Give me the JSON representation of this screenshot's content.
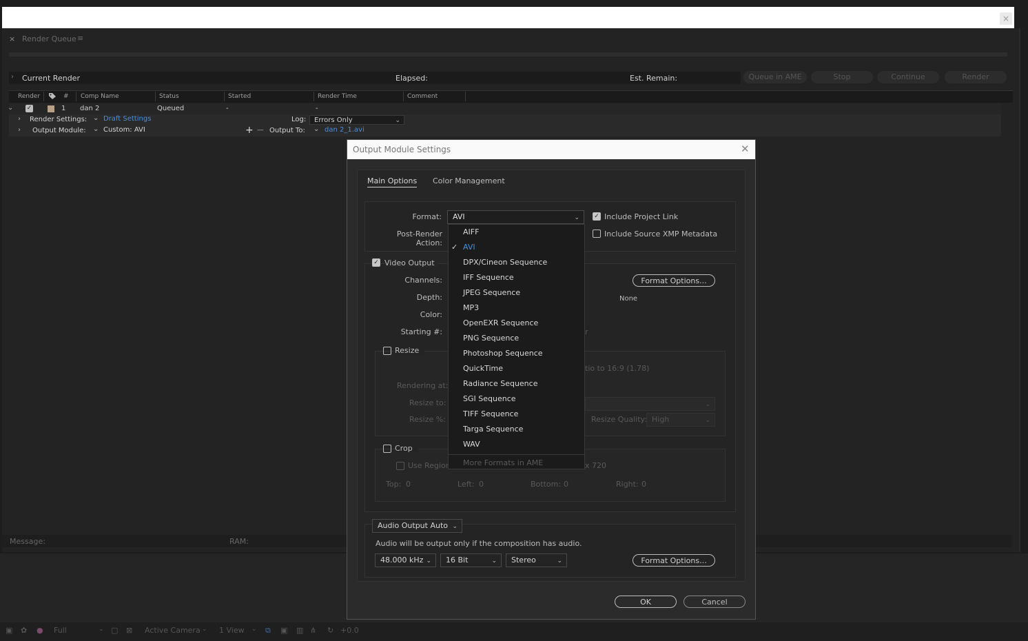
{
  "render_queue": {
    "tab_close": "×",
    "tab_title": "Render Queue",
    "tab_menu": "≡",
    "current_render": "Current Render",
    "elapsed": "Elapsed:",
    "est_remain": "Est. Remain:",
    "buttons": {
      "queue_ame": "Queue in AME",
      "stop": "Stop",
      "continue": "Continue",
      "render": "Render"
    },
    "columns": {
      "render": "Render",
      "number": "#",
      "comp_name": "Comp Name",
      "status": "Status",
      "started": "Started",
      "render_time": "Render Time",
      "comment": "Comment"
    },
    "item": {
      "number": "1",
      "comp_name": "dan 2",
      "status": "Queued",
      "started": "-",
      "render_time": "-",
      "render_settings_label": "Render Settings:",
      "render_settings_value": "Draft Settings",
      "log_label": "Log:",
      "log_value": "Errors Only",
      "output_module_label": "Output Module:",
      "output_module_value": "Custom: AVI",
      "output_to_label": "Output To:",
      "output_to_value": "dan 2_1.avi"
    },
    "message_label": "Message:",
    "ram_label": "RAM:"
  },
  "bottom_toolbar": {
    "resolution": "Full",
    "camera": "Active Camera",
    "view": "1 View",
    "exposure": "+0.0"
  },
  "dialog": {
    "title": "Output Module Settings",
    "tabs": [
      "Main Options",
      "Color Management"
    ],
    "format_label": "Format:",
    "format_value": "AVI",
    "post_render_label": "Post-Render Action:",
    "include_project_link": "Include Project Link",
    "include_xmp": "Include Source XMP Metadata",
    "video_output": "Video Output",
    "channels_label": "Channels:",
    "depth_label": "Depth:",
    "color_label": "Color:",
    "starting_label": "Starting #:",
    "format_options": "Format Options...",
    "codec_value": "None",
    "resize": "Resize",
    "rendering_at": "Rendering at:",
    "resize_to": "Resize to:",
    "resize_pct": "Resize %:",
    "aspect_partial": "tio to 16:9 (1.78)",
    "starting_partial": "r",
    "resize_quality_label": "Resize Quality:",
    "resize_quality_value": "High",
    "crop": "Crop",
    "use_region": "Use Region",
    "size_partial": "x 720",
    "crop_top": "Top:",
    "crop_left": "Left:",
    "crop_bottom": "Bottom:",
    "crop_right": "Right:",
    "crop_zero": "0",
    "audio_output": "Audio Output Auto",
    "audio_note": "Audio will be output only if the composition has audio.",
    "sample_rate": "48.000 kHz",
    "bit_depth": "16 Bit",
    "channels_audio": "Stereo",
    "audio_format_options": "Format Options...",
    "ok": "OK",
    "cancel": "Cancel"
  },
  "format_menu": {
    "items": [
      "AIFF",
      "AVI",
      "DPX/Cineon Sequence",
      "IFF Sequence",
      "JPEG Sequence",
      "MP3",
      "OpenEXR Sequence",
      "PNG Sequence",
      "Photoshop Sequence",
      "QuickTime",
      "Radiance Sequence",
      "SGI Sequence",
      "TIFF Sequence",
      "Targa Sequence",
      "WAV"
    ],
    "selected": "AVI",
    "more": "More Formats in AME"
  }
}
